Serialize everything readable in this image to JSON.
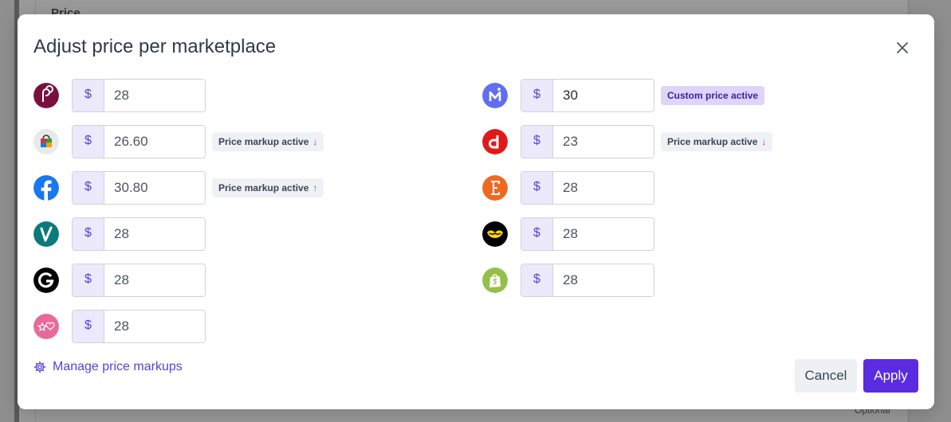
{
  "background": {
    "price_label": "Price",
    "optional_label": "Optional"
  },
  "modal": {
    "title": "Adjust price per marketplace",
    "close_icon": "close-icon",
    "currency_symbol": "$",
    "left": [
      {
        "marketplace_icon": "poshmark-icon",
        "value": "28",
        "badge": null
      },
      {
        "marketplace_icon": "shopping-bag-icon",
        "value": "26.60",
        "badge": {
          "label": "Price markup active",
          "direction": "down",
          "arrow": "↓"
        }
      },
      {
        "marketplace_icon": "facebook-icon",
        "value": "30.80",
        "badge": {
          "label": "Price markup active",
          "direction": "up",
          "arrow": "↑"
        }
      },
      {
        "marketplace_icon": "vinted-icon",
        "value": "28",
        "badge": null
      },
      {
        "marketplace_icon": "grailed-icon",
        "value": "28",
        "badge": null
      },
      {
        "marketplace_icon": "star-heart-icon",
        "value": "28",
        "badge": null
      }
    ],
    "right": [
      {
        "marketplace_icon": "mercari-icon",
        "value": "30",
        "badge": {
          "label": "Custom price active",
          "direction": "custom",
          "arrow": ""
        }
      },
      {
        "marketplace_icon": "depop-icon",
        "value": "23",
        "badge": {
          "label": "Price markup active",
          "direction": "down",
          "arrow": "↓"
        }
      },
      {
        "marketplace_icon": "etsy-icon",
        "value": "28",
        "badge": null
      },
      {
        "marketplace_icon": "heart-lips-icon",
        "value": "28",
        "badge": null
      },
      {
        "marketplace_icon": "shopify-icon",
        "value": "28",
        "badge": null
      }
    ],
    "manage_link": {
      "label": "Manage price markups",
      "icon": "gear-icon"
    },
    "cancel_label": "Cancel",
    "apply_label": "Apply",
    "colors": {
      "accent": "#5b2be0",
      "currency_bg": "#ece9fb",
      "badge_bg": "#eef1f5",
      "custom_badge_bg": "#ddd5fb",
      "down_arrow": "#e03131",
      "up_arrow": "#2f9e44"
    }
  }
}
